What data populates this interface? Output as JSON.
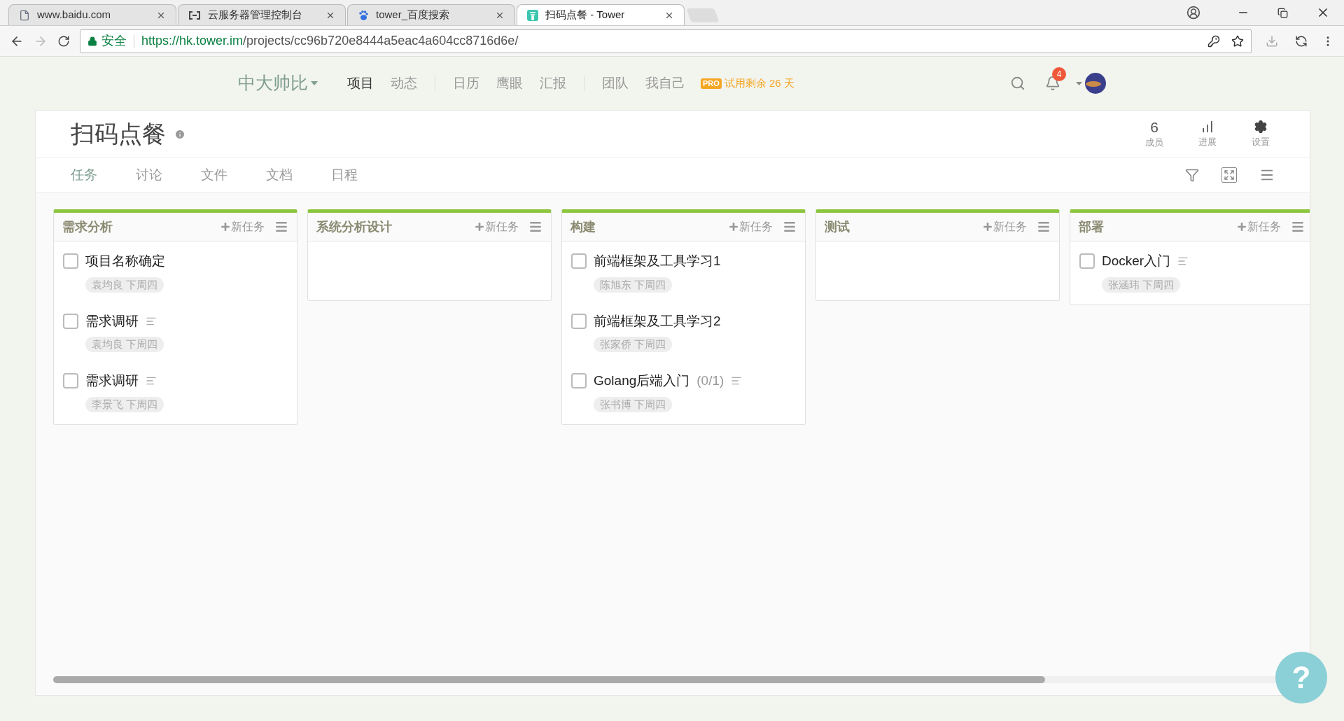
{
  "browser": {
    "tabs": [
      {
        "kind": "page",
        "title": "www.baidu.com",
        "selected": false
      },
      {
        "kind": "cloud",
        "title": "云服务器管理控制台",
        "selected": false
      },
      {
        "kind": "paw",
        "title": "tower_百度搜索",
        "selected": false
      },
      {
        "kind": "tower",
        "title": "扫码点餐 - Tower",
        "selected": true
      }
    ],
    "security": "安全",
    "url_host": "https://hk.tower.im",
    "url_path": "/projects/cc96b720e8444a5eac4a604cc8716d6e/"
  },
  "nav": {
    "brand": "中大帅比",
    "groups": [
      [
        {
          "label": "项目",
          "selected": true
        },
        {
          "label": "动态",
          "selected": false
        }
      ],
      [
        {
          "label": "日历",
          "selected": false
        },
        {
          "label": "鹰眼",
          "selected": false
        },
        {
          "label": "汇报",
          "selected": false
        }
      ],
      [
        {
          "label": "团队",
          "selected": false
        },
        {
          "label": "我自己",
          "selected": false
        }
      ]
    ],
    "pro_badge": "PRO",
    "trial": "试用剩余 26 天",
    "notifications": "4"
  },
  "project": {
    "title": "扫码点餐",
    "members_count": "6",
    "members_label": "成员",
    "progress_label": "进展",
    "settings_label": "设置",
    "tabs": [
      {
        "label": "任务",
        "selected": true
      },
      {
        "label": "讨论",
        "selected": false
      },
      {
        "label": "文件",
        "selected": false
      },
      {
        "label": "文档",
        "selected": false
      },
      {
        "label": "日程",
        "selected": false
      }
    ]
  },
  "lists": [
    {
      "title": "需求分析",
      "add": "新任务",
      "tasks": [
        {
          "title": "项目名称确定",
          "checked": false,
          "has_description": false,
          "meta": "袁均良 下周四"
        },
        {
          "title": "需求调研",
          "checked": false,
          "has_description": true,
          "meta": "袁均良 下周四"
        },
        {
          "title": "需求调研",
          "checked": false,
          "has_description": true,
          "meta": "李景飞 下周四"
        }
      ]
    },
    {
      "title": "系统分析设计",
      "add": "新任务"
    },
    {
      "title": "构建",
      "add": "新任务",
      "tasks": [
        {
          "title": "前端框架及工具学习1",
          "checked": false,
          "has_description": false,
          "meta": "陈旭东 下周四"
        },
        {
          "title": "前端框架及工具学习2",
          "checked": false,
          "has_description": false,
          "meta": "张家侨 下周四"
        },
        {
          "title": "Golang后端入门",
          "progress": "(0/1)",
          "checked": false,
          "has_description": true,
          "meta": "张书博 下周四"
        }
      ]
    },
    {
      "title": "测试",
      "add": "新任务"
    },
    {
      "title": "部署",
      "add": "新任务",
      "tasks": [
        {
          "title": "Docker入门",
          "checked": false,
          "has_description": true,
          "meta": "张涵玮 下周四"
        }
      ]
    }
  ],
  "help": "?"
}
